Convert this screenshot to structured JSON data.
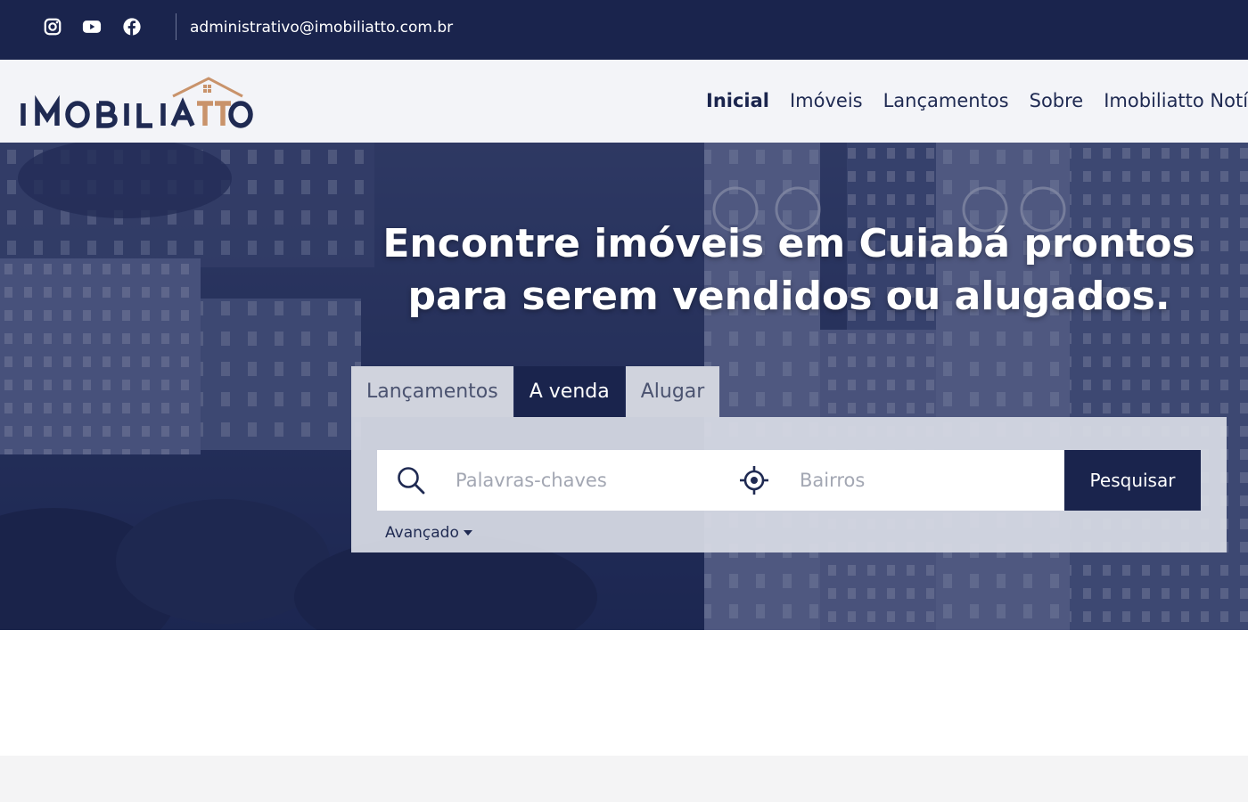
{
  "topbar": {
    "icons": [
      "instagram-icon",
      "youtube-icon",
      "facebook-icon"
    ],
    "email": "administrativo@imobiliatto.com.br",
    "background": "#1a244d"
  },
  "header": {
    "logo_text": "IMOBILIATTO",
    "nav": [
      {
        "label": "Inicial",
        "active": true
      },
      {
        "label": "Imóveis",
        "active": false
      },
      {
        "label": "Lançamentos",
        "active": false
      },
      {
        "label": "Sobre",
        "active": false
      },
      {
        "label": "Imobiliatto Notícias",
        "active": false
      }
    ]
  },
  "hero": {
    "title": "Encontre imóveis em Cuiabá prontos para serem vendidos ou alugados.",
    "tabs": [
      {
        "label": "Lançamentos",
        "active": false
      },
      {
        "label": "A venda",
        "active": true
      },
      {
        "label": "Alugar",
        "active": false
      }
    ],
    "search": {
      "keyword_placeholder": "Palavras-chaves",
      "keyword_value": "",
      "neighborhood_placeholder": "Bairros",
      "neighborhood_value": "",
      "button_label": "Pesquisar",
      "advanced_label": "Avançado"
    }
  },
  "colors": {
    "brand_navy": "#1a244d",
    "logo_accent": "#c9936b",
    "panel": "#d8dbe5"
  }
}
